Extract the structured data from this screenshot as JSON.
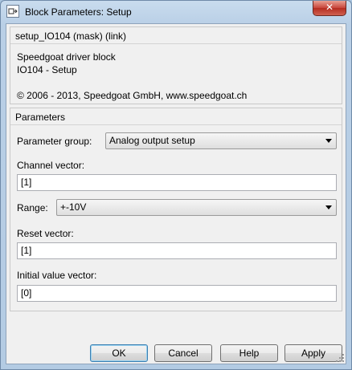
{
  "window": {
    "title": "Block Parameters: Setup",
    "close_glyph": "✕"
  },
  "description": {
    "block_title": "setup_IO104 (mask) (link)",
    "line1": "Speedgoat driver block",
    "line2": "IO104 - Setup",
    "copyright": "© 2006 - 2013, Speedgoat GmbH, www.speedgoat.ch"
  },
  "parameters": {
    "title": "Parameters",
    "parameter_group_label": "Parameter group:",
    "parameter_group_value": "Analog output setup",
    "channel_vector_label": "Channel vector:",
    "channel_vector_value": "[1]",
    "range_label": "Range:",
    "range_value": "+-10V",
    "reset_vector_label": "Reset vector:",
    "reset_vector_value": "[1]",
    "initial_value_label": "Initial value vector:",
    "initial_value_value": "[0]"
  },
  "buttons": {
    "ok": "OK",
    "cancel": "Cancel",
    "help": "Help",
    "apply": "Apply"
  },
  "icons": {
    "app": "simulink-block-icon",
    "dropdown": "chevron-down-icon",
    "resize": "resize-grip-icon"
  },
  "colors": {
    "close_button": "#c7443a",
    "accent_border": "#3c7fb1"
  }
}
